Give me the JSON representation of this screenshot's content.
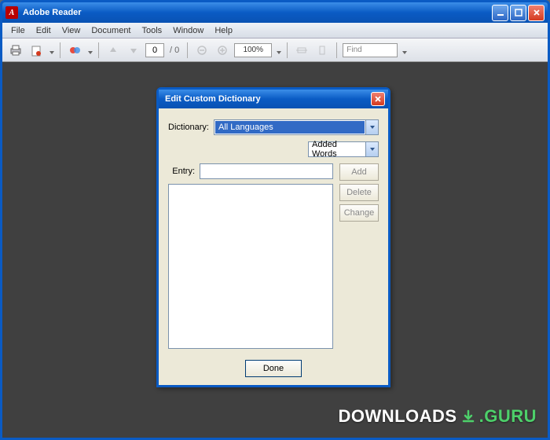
{
  "window": {
    "title": "Adobe Reader",
    "app_icon_letter": "A"
  },
  "menu": [
    "File",
    "Edit",
    "View",
    "Document",
    "Tools",
    "Window",
    "Help"
  ],
  "toolbar": {
    "page_current": "0",
    "page_total": "/ 0",
    "zoom": "100%",
    "find_placeholder": "Find"
  },
  "dialog": {
    "title": "Edit Custom Dictionary",
    "dictionary_label": "Dictionary:",
    "dictionary_value": "All Languages",
    "filter_value": "Added Words",
    "entry_label": "Entry:",
    "buttons": {
      "add": "Add",
      "delete": "Delete",
      "change": "Change",
      "done": "Done"
    }
  },
  "watermark": {
    "text1": "DOWNLOADS",
    "text2": ".GURU"
  }
}
